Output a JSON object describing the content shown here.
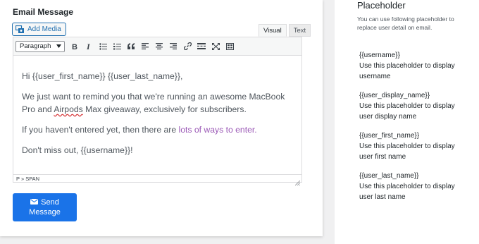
{
  "email": {
    "section_title": "Email Message",
    "add_media_label": "Add Media",
    "tabs": {
      "visual": "Visual",
      "text": "Text"
    },
    "format_select": "Paragraph",
    "content": {
      "line1": "Hi {{user_first_name}} {{user_last_name}},",
      "line2_a": "We just want to remind you that we're running an awesome MacBook Pro and ",
      "line2_spell": "Airpods",
      "line2_b": " Max giveaway, exclusively for subscribers.",
      "line3_a": "If you haven't entered yet, then there are ",
      "line3_link": "lots of ways to enter.",
      "line4": "Don't miss out, {{username}}!"
    },
    "statusbar": "P » SPAN",
    "send_button": {
      "line1": "Send",
      "line2": "Message"
    }
  },
  "placeholder_panel": {
    "title": "Placeholder",
    "description": "You can use following placeholder to replace user detail on email.",
    "items": [
      {
        "token": "{{username}}",
        "desc": "Use this placeholder to display username"
      },
      {
        "token": "{{user_display_name}}",
        "desc": "Use this placeholder to display user display name"
      },
      {
        "token": "{{user_first_name}}",
        "desc": "Use this placeholder to display user first name"
      },
      {
        "token": "{{user_last_name}}",
        "desc": "Use this placeholder to display user last name"
      }
    ]
  },
  "colors": {
    "primary": "#1a73e8",
    "link": "#9b59b6",
    "text": "#50575e"
  }
}
